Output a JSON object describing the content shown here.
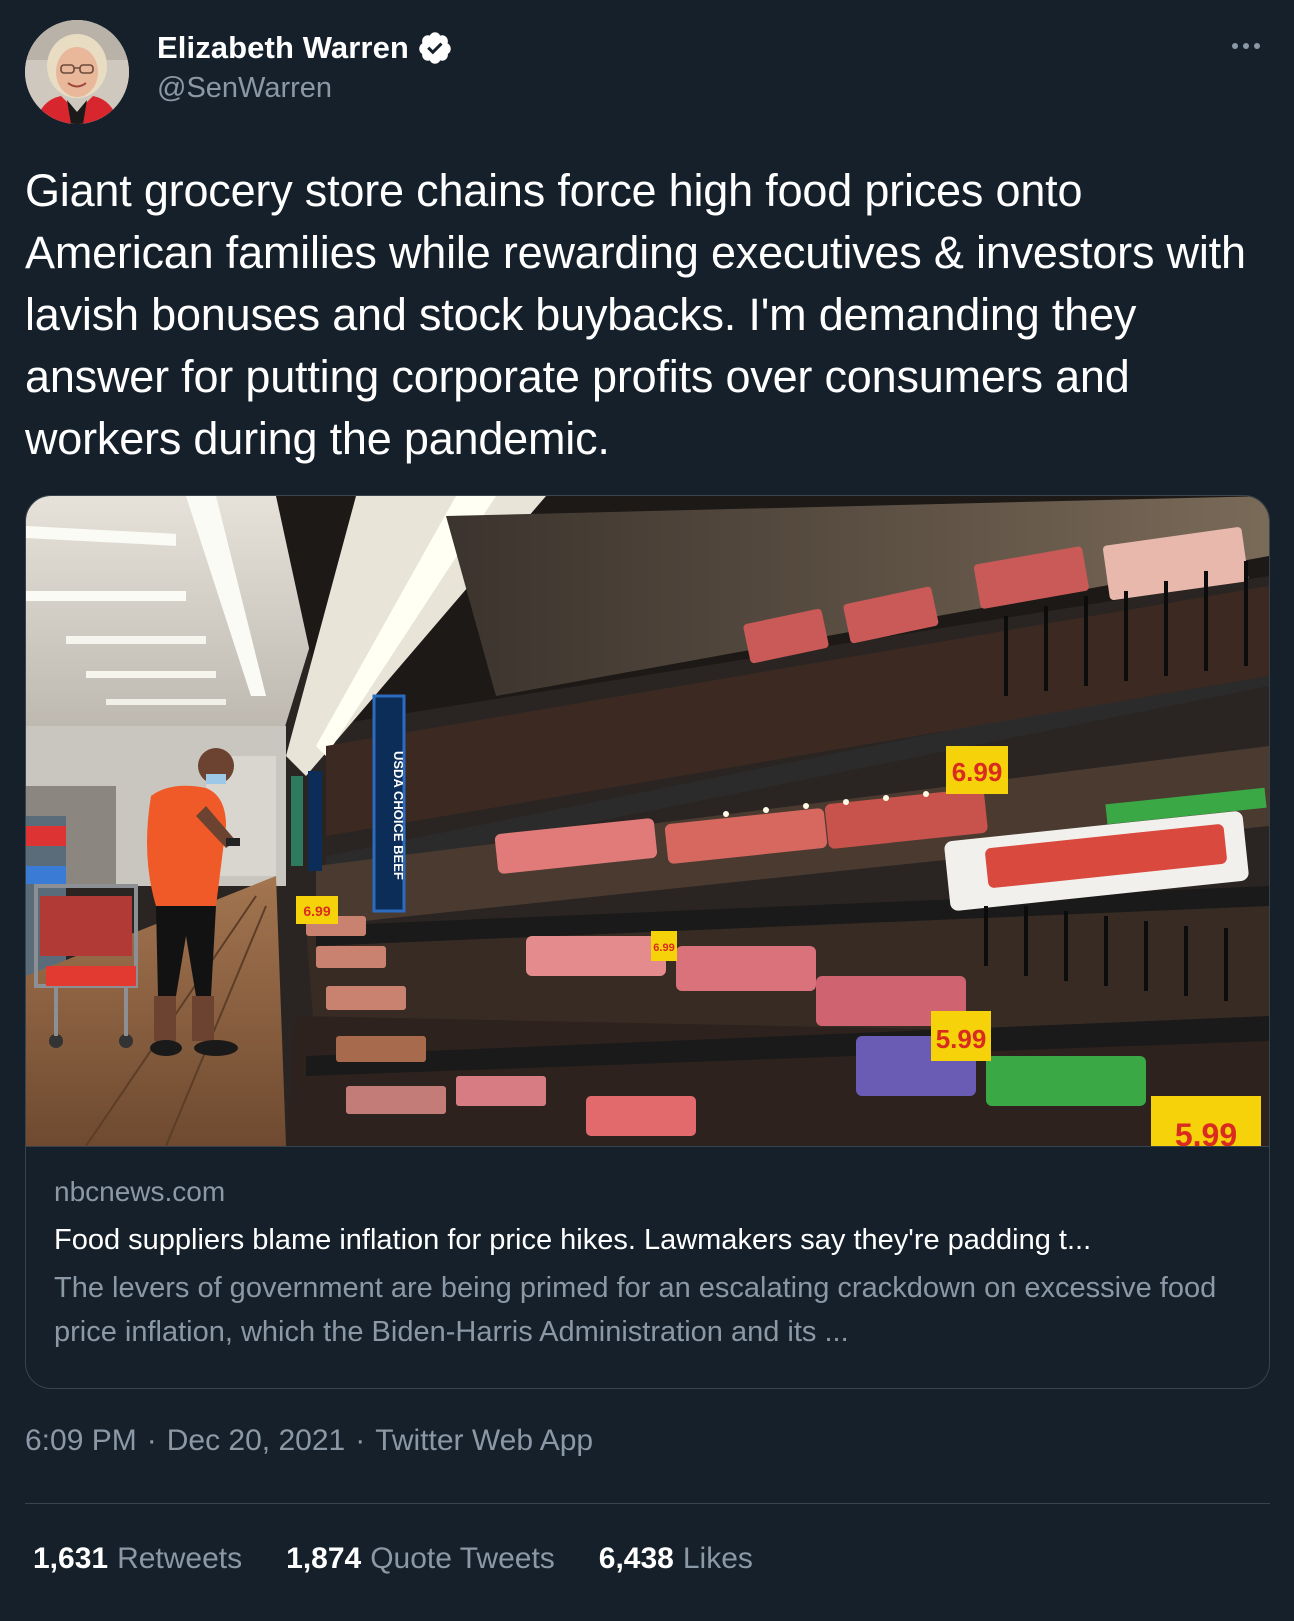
{
  "author": {
    "display_name": "Elizabeth Warren",
    "handle": "@SenWarren",
    "verified": true
  },
  "icons": {
    "avatar": "avatar-photo",
    "verified": "verified-badge-icon",
    "more": "more-options-icon"
  },
  "tweet": {
    "text": "Giant grocery store chains force high food prices onto American families while rewarding executives & investors with lavish bonuses and stock buybacks. I'm demanding they answer for putting corporate profits over consumers and workers during the pandemic."
  },
  "card": {
    "domain": "nbcnews.com",
    "title": "Food suppliers blame inflation for price hikes. Lawmakers say they're padding t...",
    "description": "The levers of government are being primed for an escalating crackdown on excessive food price inflation, which the Biden-Harris Administration and its ...",
    "image": {
      "sign_label": "USDA CHOICE BEEF",
      "price_tags": [
        "6.99",
        "6.99",
        "5.99",
        "5.99",
        "6.99"
      ]
    }
  },
  "meta": {
    "time": "6:09 PM",
    "separator": "·",
    "date": "Dec 20, 2021",
    "app": "Twitter Web App"
  },
  "stats": {
    "retweets_count": "1,631",
    "retweets_label": "Retweets",
    "quotes_count": "1,874",
    "quotes_label": "Quote Tweets",
    "likes_count": "6,438",
    "likes_label": "Likes"
  },
  "colors": {
    "background": "#15202b",
    "border": "#38444d",
    "secondary_text": "#8b98a5",
    "primary_text": "#ffffff",
    "price_tag_yellow": "#f5d20a",
    "price_tag_red": "#d92b1f"
  }
}
